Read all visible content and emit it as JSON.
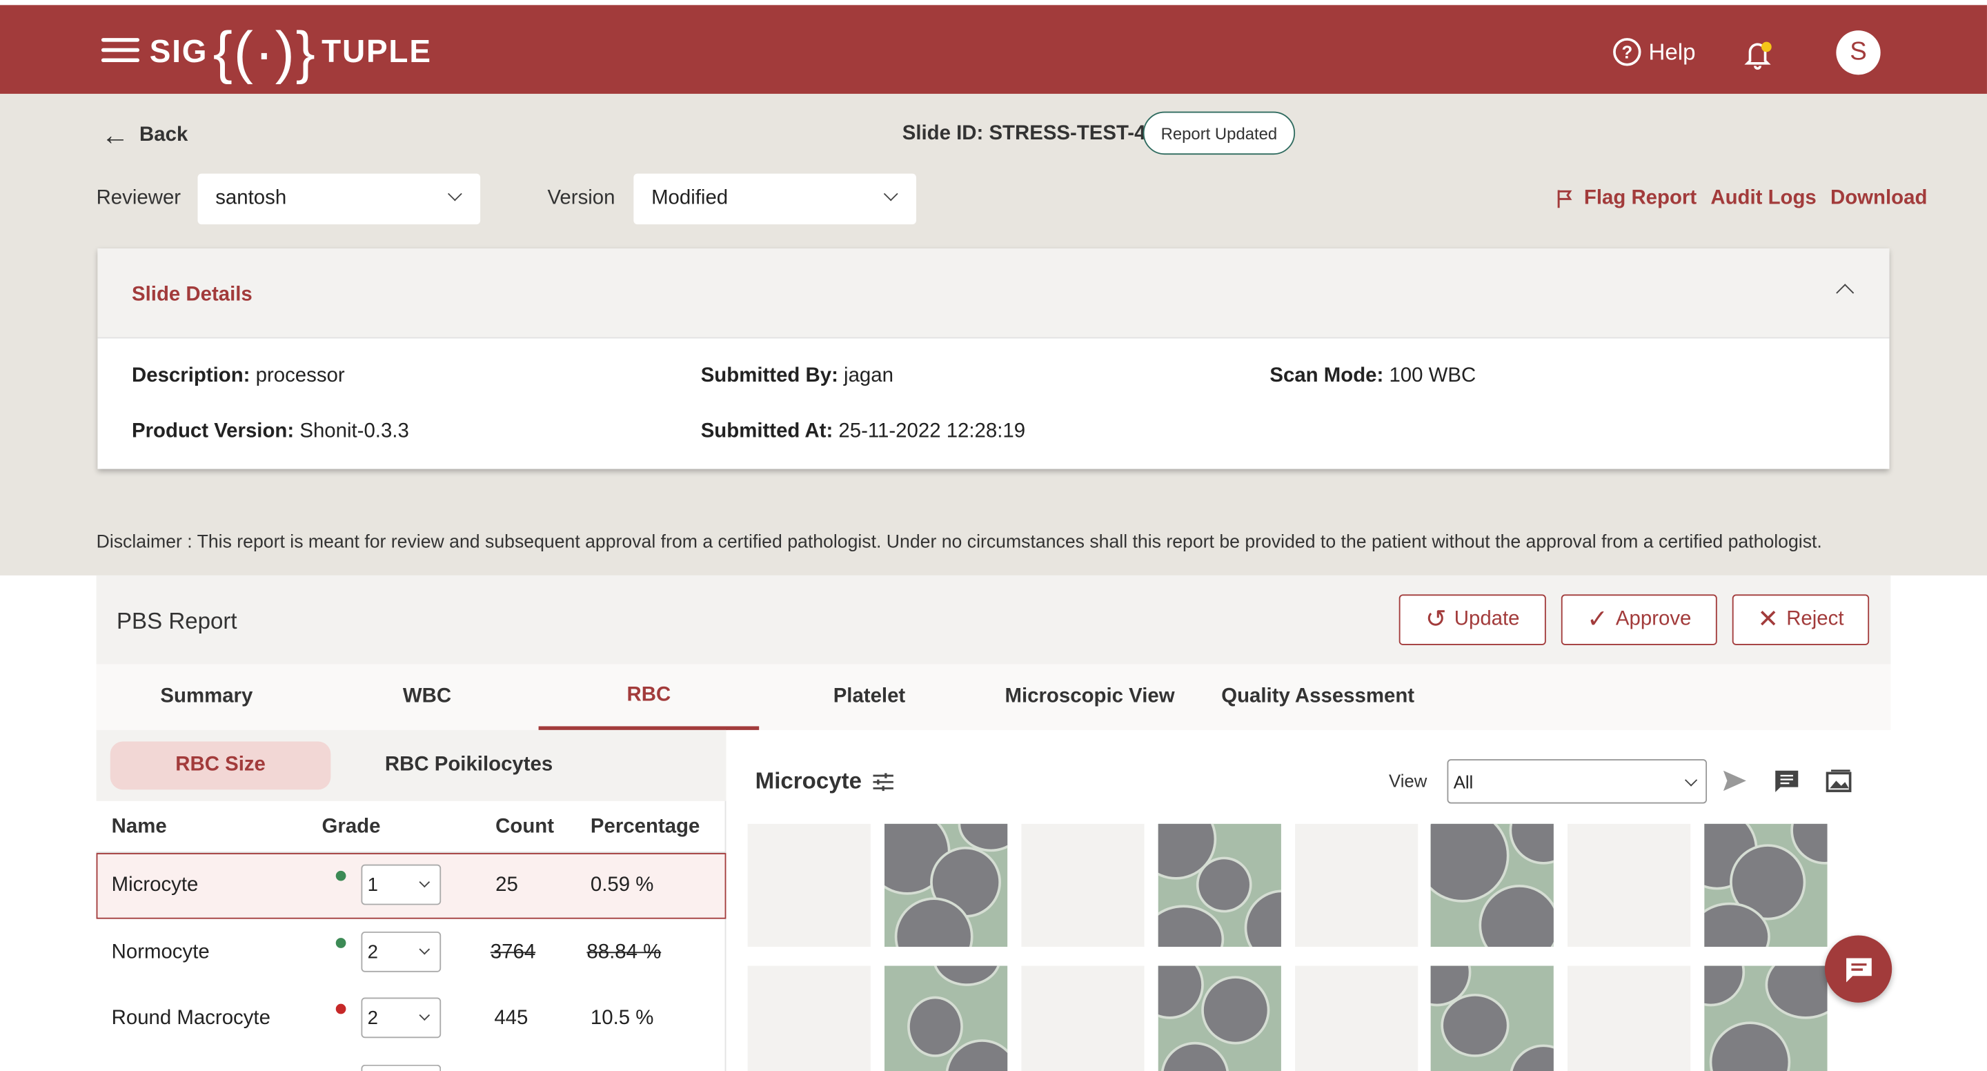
{
  "header": {
    "logo_left": "SIG",
    "logo_mid": "{(·)}",
    "logo_right": "TUPLE",
    "help_label": "Help",
    "avatar_initial": "S",
    "brand_color": "#a23b3b"
  },
  "topbar": {
    "back_label": "Back",
    "slide_id": "Slide ID: STRESS-TEST-48",
    "status_badge": "Report Updated"
  },
  "filters": {
    "reviewer_label": "Reviewer",
    "reviewer_value": "santosh",
    "version_label": "Version",
    "version_value": "Modified"
  },
  "actions": {
    "flag": "Flag Report",
    "audit": "Audit Logs",
    "download": "Download"
  },
  "slide_details": {
    "title": "Slide Details",
    "description_label": "Description:",
    "description_value": " processor",
    "submitted_by_label": "Submitted By:",
    "submitted_by_value": " jagan",
    "scan_mode_label": "Scan Mode:",
    "scan_mode_value": " 100 WBC",
    "product_version_label": "Product Version:",
    "product_version_value": " Shonit-0.3.3",
    "submitted_at_label": "Submitted At:",
    "submitted_at_value": " 25-11-2022 12:28:19"
  },
  "disclaimer": "Disclaimer :  This report is meant for review and subsequent approval from a certified pathologist. Under no circumstances shall this report be provided to the patient without the approval from a certified pathologist.",
  "report": {
    "title": "PBS Report",
    "update": "Update",
    "approve": "Approve",
    "reject": "Reject"
  },
  "tabs": [
    "Summary",
    "WBC",
    "RBC",
    "Platelet",
    "Microscopic View",
    "Quality Assessment"
  ],
  "subtabs": [
    "RBC Size",
    "RBC Poikilocytes"
  ],
  "table": {
    "headers": [
      "Name",
      "Grade",
      "Count",
      "Percentage"
    ],
    "rows": [
      {
        "name": "Microcyte",
        "grade": "1",
        "count": "25",
        "pct": "0.59 %",
        "dot": "#3c8a55"
      },
      {
        "name": "Normocyte",
        "grade": "2",
        "count": "3764",
        "pct": "88.84 %",
        "dot": "#3c8a55"
      },
      {
        "name": "Round Macrocyte",
        "grade": "2",
        "count": "445",
        "pct": "10.5 %",
        "dot": "#c62828"
      }
    ]
  },
  "gallery": {
    "title": "Microcyte",
    "view_label": "View",
    "view_value": "All"
  }
}
